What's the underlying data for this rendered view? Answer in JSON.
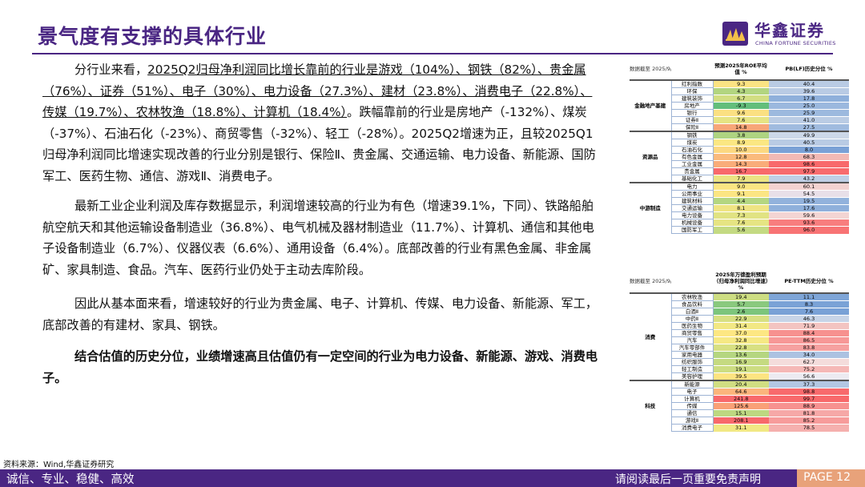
{
  "header": {
    "title": "景气度有支撑的具体行业",
    "logo_cn": "华鑫证券",
    "logo_en": "CHINA FORTUNE SECURITIES"
  },
  "body": {
    "p1": {
      "intro": "分行业来看，",
      "underlined": "2025Q2归母净利润同比增长靠前的行业是游戏（104%）、钢铁（82%）、贵金属（76%）、证券（51%）、电子（30%）、电力设备（27.3%）、建材（23.8%）、消费电子（22.8%）、传媒（19.7%）、农林牧渔（18.8%）、计算机（18.4%）",
      "rest": "。跌幅靠前的行业是房地产（-132%）、煤炭（-37%）、石油石化（-23%）、商贸零售（-32%）、轻工（-28%）。2025Q2增速为正，且较2025Q1归母净利润同比增速实现改善的行业分别是银行、保险Ⅱ、贵金属、交通运输、电力设备、新能源、国防军工、医药生物、通信、游戏Ⅱ、消费电子。"
    },
    "p2": "最新工业企业利润及库存数据显示，利润增速较高的行业为有色（增速39.1%，下同）、铁路船舶航空航天和其他运输设备制造业（36.8%）、电气机械及器材制造业（11.7%）、计算机、通信和其他电子设备制造业（6.7%）、仪器仪表（6.6%）、通用设备（6.4%）。底部改善的行业有黑色金属、非金属矿、家具制造、食品。汽车、医药行业仍处于主动去库阶段。",
    "p3": "因此从基本面来看，增速较好的行业为贵金属、电子、计算机、传媒、电力设备、新能源、军工，底部改善的有建材、家具、钢铁。",
    "p4": "结合估值的历史分位，业绩增速高且估值仍有一定空间的行业为电力设备、新能源、游戏、消费电子。"
  },
  "source": "资料来源：Wind,华鑫证券研究",
  "footer": {
    "slogan": "诚信、专业、稳健、高效",
    "disclaimer": "请阅读最后一页重要免责声明",
    "page": "PAGE 12"
  },
  "table1": {
    "date_label": "数据截至 2025/9/25",
    "col1": "预测2025年ROE平均值 %",
    "col2": "PB(LF)历史分位 %",
    "groups": [
      {
        "name": "金融地产基建",
        "rows": [
          {
            "ind": "红利指数",
            "a": "9.3",
            "b": "40.4",
            "ca": "#fbe383",
            "cb": "#b9cbe4"
          },
          {
            "ind": "环保",
            "a": "4.3",
            "b": "39.6",
            "ca": "#b2d580",
            "cb": "#b9cbe4"
          },
          {
            "ind": "建筑装饰",
            "a": "6.7",
            "b": "17.8",
            "ca": "#d2de82",
            "cb": "#8fb0db"
          },
          {
            "ind": "房地产",
            "a": "-9.3",
            "b": "25.0",
            "ca": "#63be7b",
            "cb": "#9bb8de"
          },
          {
            "ind": "银行",
            "a": "9.6",
            "b": "25.9",
            "ca": "#fbe082",
            "cb": "#9cb9de"
          },
          {
            "ind": "证券Ⅱ",
            "a": "7.6",
            "b": "41.0",
            "ca": "#e6e483",
            "cb": "#bacce4"
          },
          {
            "ind": "保险Ⅱ",
            "a": "14.8",
            "b": "27.5",
            "ca": "#f8a678",
            "cb": "#a0bbdf"
          }
        ]
      },
      {
        "name": "资源品",
        "rows": [
          {
            "ind": "钢铁",
            "a": "3.8",
            "b": "49.9",
            "ca": "#aed481",
            "cb": "#ccd8e8"
          },
          {
            "ind": "煤炭",
            "a": "8.9",
            "b": "40.5",
            "ca": "#fbe783",
            "cb": "#b9cbe4"
          },
          {
            "ind": "石油石化",
            "a": "10.0",
            "b": "8.0",
            "ca": "#fcd881",
            "cb": "#7aa1d6"
          },
          {
            "ind": "有色金属",
            "a": "12.8",
            "b": "68.3",
            "ca": "#faba7c",
            "cb": "#f1b9b5"
          },
          {
            "ind": "工业金属",
            "a": "14.3",
            "b": "98.6",
            "ca": "#f9ac79",
            "cb": "#f8696b"
          },
          {
            "ind": "贵金属",
            "a": "16.7",
            "b": "97.9",
            "ca": "#f8696b",
            "cb": "#f86b6d"
          },
          {
            "ind": "基础化工",
            "a": "7.9",
            "b": "43.2",
            "ca": "#ebe483",
            "cb": "#bfcfe5"
          }
        ]
      },
      {
        "name": "中游制造",
        "rows": [
          {
            "ind": "电力",
            "a": "9.0",
            "b": "60.1",
            "ca": "#fbe683",
            "cb": "#f3d3d1"
          },
          {
            "ind": "公用事业",
            "a": "9.1",
            "b": "54.5",
            "ca": "#fbe583",
            "cb": "#e8dfe8"
          },
          {
            "ind": "建筑材料",
            "a": "4.4",
            "b": "19.5",
            "ca": "#b4d681",
            "cb": "#92b2dc"
          },
          {
            "ind": "交通运输",
            "a": "8.1",
            "b": "17.6",
            "ca": "#efe483",
            "cb": "#8fb0db"
          },
          {
            "ind": "电力设备",
            "a": "7.3",
            "b": "59.6",
            "ca": "#e1e383",
            "cb": "#f3d5d3"
          },
          {
            "ind": "机械设备",
            "a": "7.6",
            "b": "93.6",
            "ca": "#e6e483",
            "cb": "#f87d7e"
          },
          {
            "ind": "国防军工",
            "a": "5.6",
            "b": "96.0",
            "ca": "#c4da82",
            "cb": "#f87374"
          }
        ]
      }
    ]
  },
  "table2": {
    "date_label": "数据截至 2025/9/25",
    "col1": "2025年万德盈利预期（归母净利润同比增速）%",
    "col2": "PE-TTM历史分位 %",
    "groups": [
      {
        "name": "消费",
        "rows": [
          {
            "ind": "农林牧渔",
            "a": "19.4",
            "b": "11.1",
            "ca": "#cddd82",
            "cb": "#7ea5d7"
          },
          {
            "ind": "食品饮料",
            "a": "5.7",
            "b": "8.3",
            "ca": "#8ac97e",
            "cb": "#7aa2d6"
          },
          {
            "ind": "白酒Ⅱ",
            "a": "2.6",
            "b": "7.6",
            "ca": "#7cc57c",
            "cb": "#79a1d6"
          },
          {
            "ind": "中药Ⅱ",
            "a": "22.9",
            "b": "46.3",
            "ca": "#d8e082",
            "cb": "#c7d4e7"
          },
          {
            "ind": "医药生物",
            "a": "31.4",
            "b": "71.9",
            "ca": "#f2e884",
            "cb": "#f3c4c1"
          },
          {
            "ind": "商贸零售",
            "a": "37.0",
            "b": "88.4",
            "ca": "#fde783",
            "cb": "#f7918f"
          },
          {
            "ind": "汽车",
            "a": "32.8",
            "b": "86.5",
            "ca": "#f6e984",
            "cb": "#f79897"
          },
          {
            "ind": "汽车零部件",
            "a": "22.8",
            "b": "83.8",
            "ca": "#d8e082",
            "cb": "#f6a1a0"
          },
          {
            "ind": "家用电器",
            "a": "13.6",
            "b": "34.0",
            "ca": "#b5d680",
            "cb": "#acc2e1"
          },
          {
            "ind": "纺织服饰",
            "a": "16.9",
            "b": "62.7",
            "ca": "#c5da81",
            "cb": "#f4dcdb"
          },
          {
            "ind": "轻工制造",
            "a": "19.1",
            "b": "75.2",
            "ca": "#cddd82",
            "cb": "#f5b8b6"
          },
          {
            "ind": "美容护理",
            "a": "39.5",
            "b": "56.6",
            "ca": "#fde482",
            "cb": "#ecebf1"
          }
        ]
      },
      {
        "name": "科技",
        "rows": [
          {
            "ind": "新能源",
            "a": "20.4",
            "b": "37.3",
            "ca": "#d1de82",
            "cb": "#b3c7e3"
          },
          {
            "ind": "电子",
            "a": "64.6",
            "b": "98.8",
            "ca": "#fbb57c",
            "cb": "#f86a6c"
          },
          {
            "ind": "计算机",
            "a": "241.8",
            "b": "99.7",
            "ca": "#f8696b",
            "cb": "#f8696b"
          },
          {
            "ind": "传媒",
            "a": "125.6",
            "b": "88.9",
            "ca": "#f9a077",
            "cb": "#f79190"
          },
          {
            "ind": "通信",
            "a": "15.1",
            "b": "81.8",
            "ca": "#bdd881",
            "cb": "#f6a8a7"
          },
          {
            "ind": "游戏Ⅱ",
            "a": "208.1",
            "b": "85.2",
            "ca": "#f8696b",
            "cb": "#f79c9b"
          },
          {
            "ind": "消费电子",
            "a": "31.1",
            "b": "78.5",
            "ca": "#f1e884",
            "cb": "#f5b0ae"
          }
        ]
      }
    ]
  }
}
